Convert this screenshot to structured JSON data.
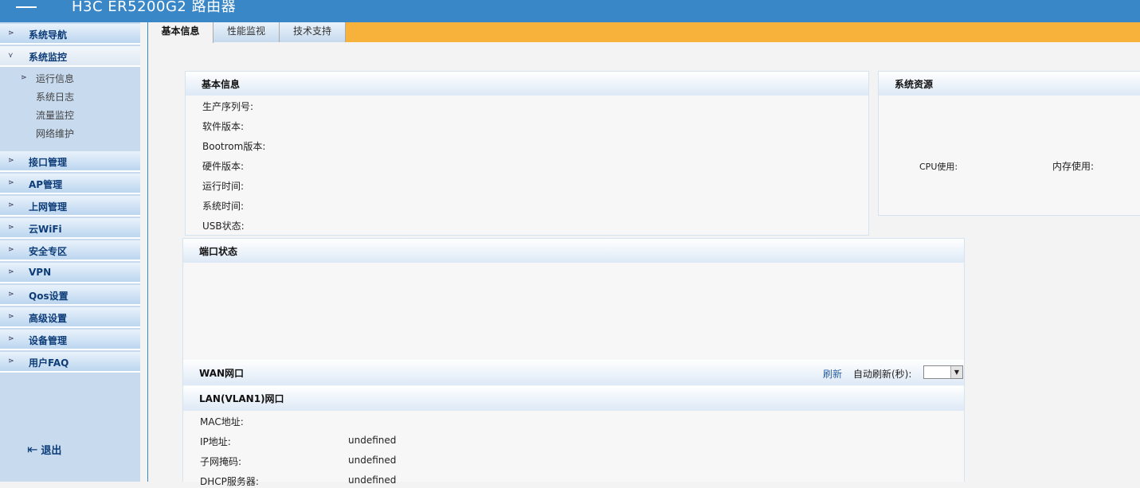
{
  "header": {
    "title": "H3C ER5200G2 路由器"
  },
  "sidebar": {
    "items": [
      {
        "label": "系统导航"
      },
      {
        "label": "系统监控"
      },
      {
        "label": "接口管理"
      },
      {
        "label": "AP管理"
      },
      {
        "label": "上网管理"
      },
      {
        "label": "云WiFi"
      },
      {
        "label": "安全专区"
      },
      {
        "label": "VPN"
      },
      {
        "label": "Qos设置"
      },
      {
        "label": "高级设置"
      },
      {
        "label": "设备管理"
      },
      {
        "label": "用户FAQ"
      }
    ],
    "sub_items": [
      {
        "label": "运行信息"
      },
      {
        "label": "系统日志"
      },
      {
        "label": "流量监控"
      },
      {
        "label": "网络维护"
      }
    ],
    "logout": "退出"
  },
  "tabs": [
    {
      "label": "基本信息"
    },
    {
      "label": "性能监视"
    },
    {
      "label": "技术支持"
    }
  ],
  "basic_info": {
    "title": "基本信息",
    "rows": [
      "生产序列号:",
      "软件版本:",
      "Bootrom版本:",
      "硬件版本:",
      "运行时间:",
      "系统时间:",
      "USB状态:"
    ]
  },
  "resources": {
    "title": "系统资源",
    "cpu_label": "CPU使用:",
    "mem_label": "内存使用:"
  },
  "port_status": {
    "title": "端口状态"
  },
  "wan": {
    "title": "WAN网口",
    "refresh": "刷新",
    "auto_refresh_label": "自动刷新(秒):",
    "auto_refresh_value": ""
  },
  "lan": {
    "title": "LAN(VLAN1)网口",
    "rows": [
      {
        "label": "MAC地址:",
        "value": ""
      },
      {
        "label": "IP地址:",
        "value": "undefined"
      },
      {
        "label": "子网掩码:",
        "value": "undefined"
      },
      {
        "label": "DHCP服务器:",
        "value": "undefined"
      }
    ]
  }
}
